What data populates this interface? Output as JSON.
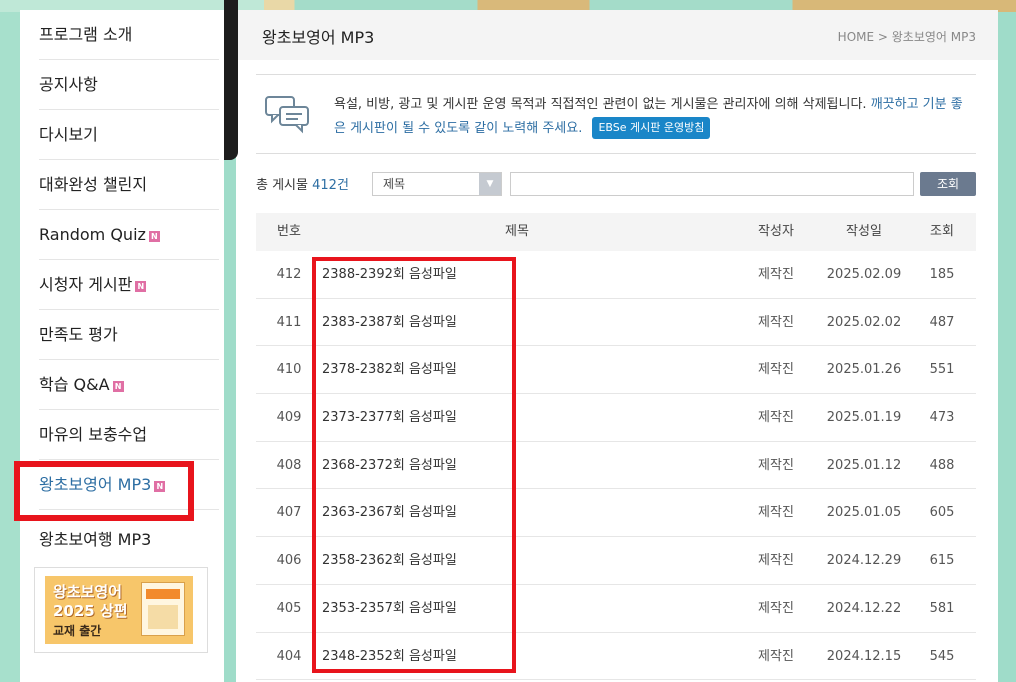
{
  "sidebar": {
    "items": [
      {
        "label": "프로그램 소개",
        "badge": ""
      },
      {
        "label": "공지사항",
        "badge": ""
      },
      {
        "label": "다시보기",
        "badge": ""
      },
      {
        "label": "대화완성 챌린지",
        "badge": ""
      },
      {
        "label": "Random Quiz",
        "badge": "N"
      },
      {
        "label": "시청자 게시판",
        "badge": "N"
      },
      {
        "label": "만족도 평가",
        "badge": ""
      },
      {
        "label": "학습 Q&A",
        "badge": "N"
      },
      {
        "label": "마유의 보충수업",
        "badge": ""
      },
      {
        "label": "왕초보영어 MP3",
        "badge": "N"
      },
      {
        "label": "왕초보여행 MP3",
        "badge": ""
      }
    ],
    "banner": {
      "line1": "왕초보영어",
      "line2": "2025 상편",
      "line3": "교재 출간"
    }
  },
  "header": {
    "title": "왕초보영어 MP3",
    "breadcrumb": "HOME > 왕초보영어 MP3"
  },
  "notice": {
    "text_main": "욕설, 비방, 광고 및 게시판 운영 목적과 직접적인 관련이 없는 게시물은 관리자에 의해 삭제됩니다.",
    "text_blue": "깨끗하고 기분 좋은 게시판이 될 수 있도록 같이 노력해 주세요.",
    "policy_button": "EBSe 게시판 운영방침"
  },
  "search": {
    "total_prefix": "총 게시물",
    "total_count": "412건",
    "select_value": "제목",
    "input_value": "",
    "button_label": "조회"
  },
  "table": {
    "headers": {
      "no": "번호",
      "title": "제목",
      "writer": "작성자",
      "date": "작성일",
      "views": "조회"
    },
    "rows": [
      {
        "no": "412",
        "title": "2388-2392회 음성파일",
        "writer": "제작진",
        "date": "2025.02.09",
        "views": "185"
      },
      {
        "no": "411",
        "title": "2383-2387회 음성파일",
        "writer": "제작진",
        "date": "2025.02.02",
        "views": "487"
      },
      {
        "no": "410",
        "title": "2378-2382회 음성파일",
        "writer": "제작진",
        "date": "2025.01.26",
        "views": "551"
      },
      {
        "no": "409",
        "title": "2373-2377회 음성파일",
        "writer": "제작진",
        "date": "2025.01.19",
        "views": "473"
      },
      {
        "no": "408",
        "title": "2368-2372회 음성파일",
        "writer": "제작진",
        "date": "2025.01.12",
        "views": "488"
      },
      {
        "no": "407",
        "title": "2363-2367회 음성파일",
        "writer": "제작진",
        "date": "2025.01.05",
        "views": "605"
      },
      {
        "no": "406",
        "title": "2358-2362회 음성파일",
        "writer": "제작진",
        "date": "2024.12.29",
        "views": "615"
      },
      {
        "no": "405",
        "title": "2353-2357회 음성파일",
        "writer": "제작진",
        "date": "2024.12.22",
        "views": "581"
      },
      {
        "no": "404",
        "title": "2348-2352회 음성파일",
        "writer": "제작진",
        "date": "2024.12.15",
        "views": "545"
      }
    ]
  },
  "colors": {
    "background": "#9fdcc9",
    "accent_blue": "#2d6ea3",
    "highlight_red": "#e8141c",
    "policy_button": "#1a86c8",
    "search_button": "#6b7a8f"
  }
}
